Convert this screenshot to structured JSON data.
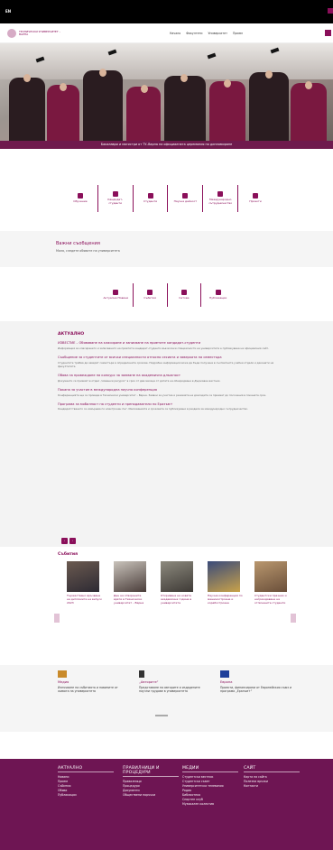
{
  "topbar": {
    "lang": "EN"
  },
  "header": {
    "logo_text": "ТЕХНИЧЕСКИ УНИВЕРСИТЕТ – ВАРНА",
    "menu": [
      "Начало",
      "Факултети",
      "Университет",
      "Прием"
    ]
  },
  "hero": {
    "caption": "Бакалаври и магистри от ТУ–Варна на официалната церемония по дипломиране"
  },
  "quick_links": [
    {
      "label": "Обучение",
      "icon": "graduation-icon"
    },
    {
      "label": "Кандидат-студенти",
      "icon": "student-icon"
    },
    {
      "label": "Студенти",
      "icon": "id-card-icon"
    },
    {
      "label": "Научна дейност",
      "icon": "book-icon"
    },
    {
      "label": "Международно сътрудничество",
      "icon": "globe-icon"
    },
    {
      "label": "Проекти",
      "icon": "monitor-icon"
    }
  ],
  "band": {
    "title": "Важни съобщения",
    "subtitle": "Моля, следете обявите на университета"
  },
  "quick_links2": [
    {
      "label": "Актуални Новини",
      "icon": "news-icon"
    },
    {
      "label": "Събития",
      "icon": "calendar-icon"
    },
    {
      "label": "Сетове",
      "icon": "people-icon"
    },
    {
      "label": "Публикации",
      "icon": "publication-icon"
    }
  ],
  "news": {
    "title": "АКТУАЛНО",
    "items": [
      {
        "h": "ИЗВЕСТИЕ – Обявяване на класиране и записване на приетите кандидат-студенти",
        "b": "Информация за класирането и записването на приетите кандидат-студенти във всички специалности на университета е публикувана на официалния сайт."
      },
      {
        "h": "Съобщение за студентите от всички специалности относно сесията и заверката на семестъра",
        "b": "Студентите трябва да заверят семестъра в определените срокове. Подробна информация може да бъде получена в съответните учебни отдели и деканати на факултетите."
      },
      {
        "h": "Обява за провеждане на конкурс за заемане на академична длъжност",
        "b": "Документи се приемат в отдел „Човешки ресурси“ в срок от два месеца от датата на обнародване в Държавен вестник."
      },
      {
        "h": "Покана за участие в международна научна конференция",
        "b": "Конференцията ще се проведе в Технически университет – Варна. Заявки за участие и резюмета на докладите се приемат до посочения в поканата срок."
      },
      {
        "h": "Програма за мобилност на студенти и преподаватели по Еразъм+",
        "b": "Кандидатстването се извършва по електронен път. Изискванията и сроковете са публикувани в раздела за международно сътрудничество."
      }
    ],
    "pager": [
      "‹",
      "›"
    ]
  },
  "events": {
    "title": "Събития",
    "cards": [
      {
        "t": "Тържествено връчване на дипломите на випуск 2023"
      },
      {
        "t": "Ден на отворените врати в Технически университет – Варна"
      },
      {
        "t": "Откриване на новата академична година в университета"
      },
      {
        "t": "Научна конференция по машиностроене и корабостроене"
      },
      {
        "t": "Студентски празник и награждаване на отличените студенти"
      }
    ]
  },
  "info": [
    {
      "h": "Медия",
      "t": "Излъчване на събитията и новините от живота на университета",
      "icon": "media-icon"
    },
    {
      "h": "„Авторите“",
      "t": "Представяне на авторите и издадените научни трудове в университета",
      "icon": "pen-icon"
    },
    {
      "h": "Европа",
      "t": "Проекти, финансирани от Европейския съюз и програма „Еразъм+“",
      "icon": "eu-flag-icon"
    }
  ],
  "footer": [
    {
      "h": "АКТУАЛНО",
      "items": [
        "Новини",
        "Прием",
        "Събития",
        "Обяви",
        "Публикации"
      ]
    },
    {
      "h": "ПРАВИЛНИЦИ И ПРОЦЕДУРИ",
      "items": [
        "Правилници",
        "Процедури",
        "Документи",
        "Обществени поръчки"
      ]
    },
    {
      "h": "МЕДИИ",
      "items": [
        "Студентски вестник",
        "Студентски съвет",
        "Университетска телевизия",
        "Радио",
        "Библиотека",
        "Спортен клуб",
        "Музикален колектив"
      ]
    },
    {
      "h": "САЙТ",
      "items": [
        "Карта на сайта",
        "Полезни връзки",
        "Контакти"
      ]
    }
  ],
  "colors": {
    "accent": "#8a0f5a",
    "footer": "#6e1553",
    "caption": "#6f1a4d"
  }
}
